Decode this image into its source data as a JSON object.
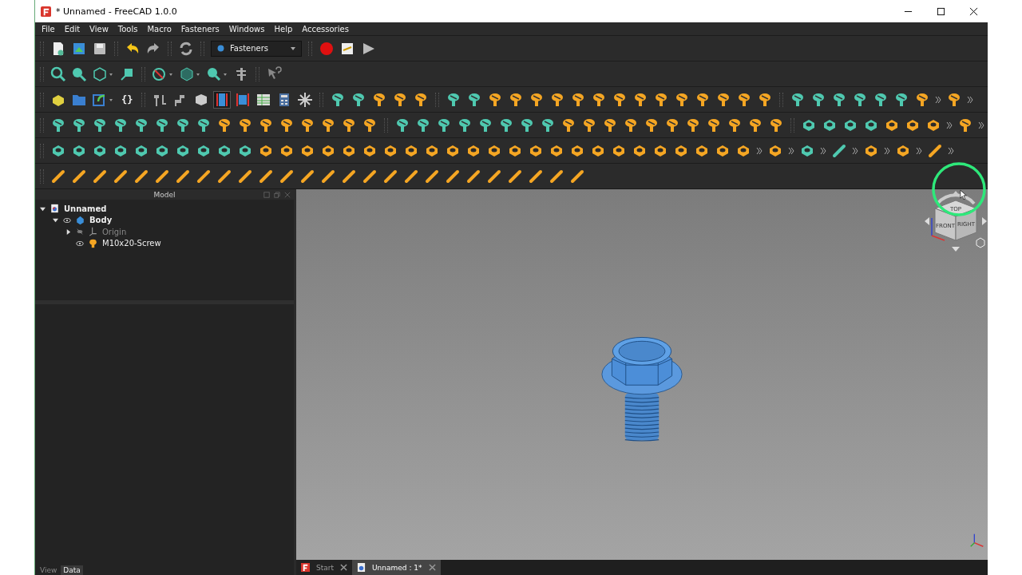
{
  "window": {
    "title": "* Unnamed - FreeCAD 1.0.0"
  },
  "menu": [
    "File",
    "Edit",
    "View",
    "Tools",
    "Macro",
    "Fasteners",
    "Windows",
    "Help",
    "Accessories"
  ],
  "workbench": {
    "value": "Fasteners"
  },
  "toolbar_text": "{}",
  "model_panel": {
    "title": "Model",
    "tree": [
      {
        "label": "Unnamed",
        "kind": "document",
        "expanded": true,
        "children": [
          {
            "label": "Body",
            "kind": "body",
            "expanded": true,
            "visible": true,
            "children": [
              {
                "label": "Origin",
                "kind": "origin",
                "expanded": false,
                "visible": false
              },
              {
                "label": "M10x20-Screw",
                "kind": "part",
                "visible": true
              }
            ]
          }
        ]
      }
    ]
  },
  "panel_tabs": [
    {
      "label": "View",
      "selected": false
    },
    {
      "label": "Data",
      "selected": true
    }
  ],
  "nav_cube": {
    "faces": [
      "TOP",
      "FRONT",
      "RIGHT"
    ]
  },
  "document_tabs": [
    {
      "label": "Start",
      "selected": false
    },
    {
      "label": "Unnamed : 1*",
      "selected": true
    }
  ]
}
